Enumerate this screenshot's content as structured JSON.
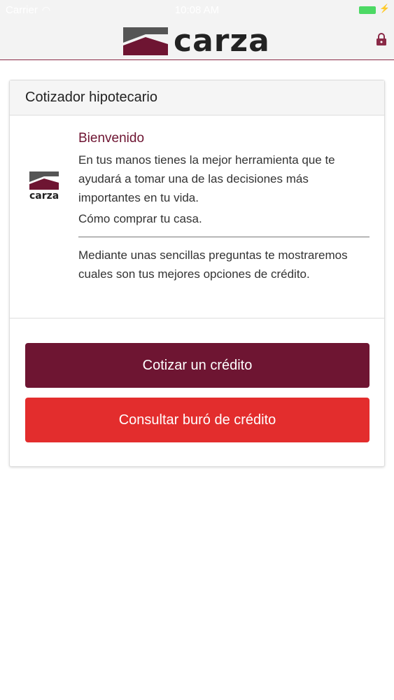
{
  "status_bar": {
    "carrier": "Carrier",
    "time": "10:08 AM"
  },
  "app_bar": {
    "brand_name": "carza",
    "icons": {
      "lock": "lock-icon"
    }
  },
  "card": {
    "title": "Cotizador hipotecario",
    "logo_text": "carza",
    "welcome_title": "Bienvenido",
    "intro_text": "En tus manos tienes la mejor herramienta que te ayudará a tomar una de las decisiones más importantes en tu vida.",
    "sub_text": "Cómo comprar tu casa.",
    "description": "Mediante unas sencillas preguntas te mostraremos cuales son tus mejores opciones de crédito.",
    "primary_button": "Cotizar un crédito",
    "secondary_button": "Consultar buró de crédito"
  },
  "colors": {
    "brand": "#6e1532",
    "danger": "#e32d2d",
    "roof_gray": "#555555",
    "battery": "#4cd964"
  }
}
